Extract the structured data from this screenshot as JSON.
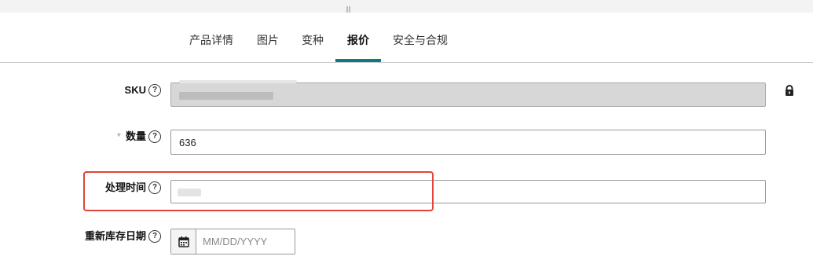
{
  "tabs": [
    {
      "label": "产品详情",
      "active": false
    },
    {
      "label": "图片",
      "active": false
    },
    {
      "label": "变种",
      "active": false
    },
    {
      "label": "报价",
      "active": true
    },
    {
      "label": "安全与合规",
      "active": false
    }
  ],
  "colors": {
    "accent": "#0a7b83",
    "highlight": "#e0443a",
    "disabled_bg": "#d7d7d7"
  },
  "fields": {
    "sku": {
      "label": "SKU",
      "value": "",
      "locked": true,
      "icon": "lock-icon"
    },
    "quantity": {
      "required_mark": "*",
      "label": "数量",
      "value": "636"
    },
    "handling_time": {
      "label": "处理时间",
      "value": ""
    },
    "restock_date": {
      "label": "重新库存日期",
      "placeholder": "MM/DD/YYYY",
      "icon": "calendar-icon"
    }
  },
  "help_icon_glyph": "?"
}
